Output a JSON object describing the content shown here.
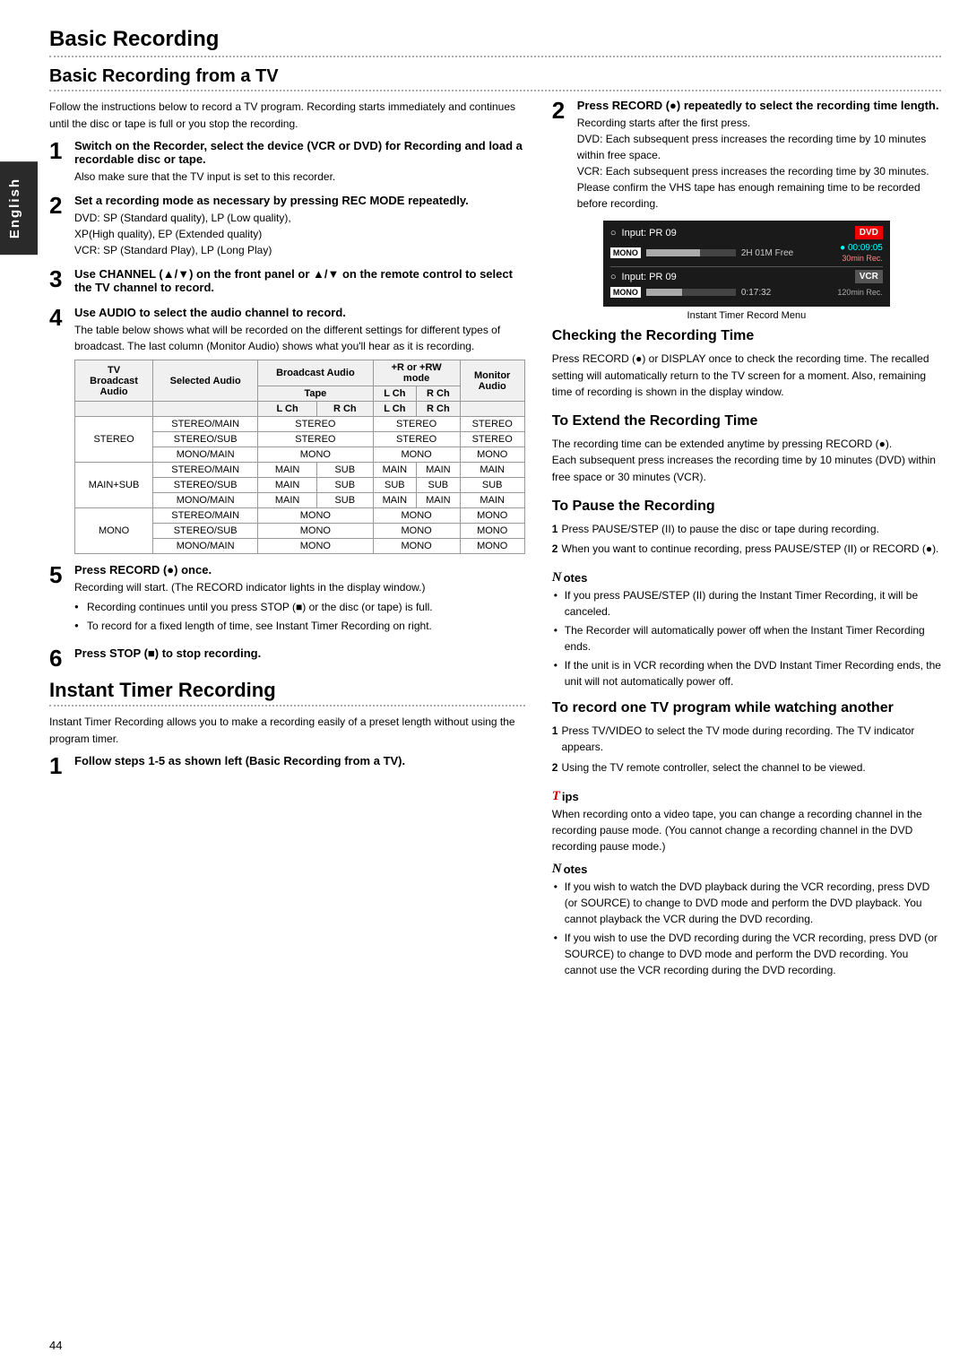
{
  "page": {
    "number": "44",
    "sidebar_label": "English"
  },
  "top_section": {
    "title": "Basic Recording",
    "subtitle": "Basic Recording from a TV",
    "intro": "Follow the instructions below to record a TV program. Recording starts immediately and continues until the disc or tape is full or you stop the recording."
  },
  "steps_left": [
    {
      "num": "1",
      "title": "Switch on the Recorder, select the device (VCR or DVD) for Recording and load a recordable disc or tape.",
      "body": "Also make sure that the TV input is set to this recorder."
    },
    {
      "num": "2",
      "title": "Set a recording mode as necessary by pressing REC MODE repeatedly.",
      "body": "DVD: SP (Standard quality), LP (Low quality), XP(High quality), EP (Extended quality)\nVCR: SP (Standard Play), LP (Long Play)"
    },
    {
      "num": "3",
      "title": "Use CHANNEL (▲/▼) on the front panel or ▲/▼ on the remote control to select the TV channel to record.",
      "body": ""
    },
    {
      "num": "4",
      "title": "Use AUDIO to select the audio channel to record.",
      "body": "The table below shows what will be recorded on the different settings for different types of broadcast. The last column (Monitor Audio) shows what you'll hear as it is recording."
    }
  ],
  "table": {
    "headers": [
      "TV Broadcast Audio",
      "Selected Audio",
      "Broadcast Audio Tape L Ch",
      "Broadcast Audio Tape R Ch",
      "Broadcast Audio +R or +RW mode L Ch",
      "Broadcast Audio +R or +RW mode R Ch",
      "Monitor Audio"
    ],
    "rows": [
      [
        "STEREO",
        "STEREO/MAIN",
        "STEREO",
        "",
        "STEREO",
        "",
        "STEREO"
      ],
      [
        "",
        "STEREO/SUB",
        "STEREO",
        "",
        "STEREO",
        "",
        "STEREO"
      ],
      [
        "",
        "MONO/MAIN",
        "MONO",
        "",
        "MONO",
        "",
        "MONO"
      ],
      [
        "MAIN+SUB",
        "STEREO/MAIN",
        "MAIN",
        "SUB",
        "MAIN",
        "MAIN",
        "MAIN"
      ],
      [
        "",
        "STEREO/SUB",
        "MAIN",
        "SUB",
        "SUB",
        "SUB",
        "SUB"
      ],
      [
        "",
        "MONO/MAIN",
        "MAIN",
        "SUB",
        "MAIN",
        "MAIN",
        "MAIN"
      ],
      [
        "MONO",
        "STEREO/MAIN",
        "MONO",
        "",
        "MONO",
        "",
        "MONO"
      ],
      [
        "",
        "STEREO/SUB",
        "MONO",
        "",
        "MONO",
        "",
        "MONO"
      ],
      [
        "",
        "MONO/MAIN",
        "MONO",
        "",
        "MONO",
        "",
        "MONO"
      ]
    ]
  },
  "steps_left_2": [
    {
      "num": "5",
      "title": "Press RECORD (●) once.",
      "body": "Recording will start. (The RECORD indicator lights in the display window.)"
    },
    {
      "num": "6",
      "title": "Press STOP (■) to stop recording.",
      "body": ""
    }
  ],
  "bullets_step5": [
    "Recording continues until you press STOP (■) or the disc (or tape) is full.",
    "To record for a fixed length of time, see Instant Timer Recording on right."
  ],
  "instant_section": {
    "title": "Instant Timer Recording",
    "intro": "Instant Timer Recording allows you to make a recording easily of a preset length without using the program timer.",
    "step1_title": "Follow steps 1-5 as shown left (Basic Recording from a TV).",
    "step1_num": "1"
  },
  "right_col": {
    "step2_title": "Press RECORD (●) repeatedly to select the recording time length.",
    "step2_num": "2",
    "step2_body": "Recording starts after the first press.",
    "step2_dvd": "DVD: Each subsequent press increases the recording time by 10 minutes within free space.",
    "step2_vcr": "VCR: Each subsequent press increases the recording time by 30 minutes. Please confirm the VHS tape has enough remaining time to be recorded before recording.",
    "menu_caption": "Instant Timer Record Menu",
    "menu_dvd_label": "DVD",
    "menu_dvd_input": "Input: PR 09",
    "menu_dvd_mono": "MONO",
    "menu_dvd_time": "2H 01M Free",
    "menu_dvd_counter": "● 00:09:05",
    "menu_dvd_rec": "30min Rec.",
    "menu_vcr_label": "VCR",
    "menu_vcr_input": "Input: PR 09",
    "menu_vcr_mono": "MONO",
    "menu_vcr_time": "0:17:32",
    "menu_vcr_rec": "120min Rec."
  },
  "checking_section": {
    "title": "Checking the Recording Time",
    "body": "Press RECORD (●) or DISPLAY once to check the recording time. The recalled setting will automatically return to the TV screen for a moment. Also, remaining time of recording is shown in the display window."
  },
  "extend_section": {
    "title": "To Extend the Recording Time",
    "body": "The recording time can be extended anytime by pressing RECORD (●).\nEach subsequent press increases the recording time by 10 minutes (DVD) within free space or 30 minutes (VCR)."
  },
  "pause_section": {
    "title": "To Pause the Recording",
    "step1": "Press PAUSE/STEP (II) to pause the disc or tape during recording.",
    "step2": "When you want to continue recording, press PAUSE/STEP (II) or RECORD (●)."
  },
  "notes_right": [
    "If you press PAUSE/STEP (II) during the Instant Timer Recording, it will be canceled.",
    "The Recorder will automatically power off when the Instant Timer Recording ends.",
    "If the unit is in VCR recording when the DVD Instant Timer Recording ends, the unit will not automatically power off."
  ],
  "record_while_watching": {
    "title": "To record one TV program while watching another",
    "step1": "Press TV/VIDEO to select the TV mode during recording. The TV indicator appears.",
    "step2": "Using the TV remote controller, select the channel to be viewed."
  },
  "tips_right": "When recording onto a video tape, you can change a recording channel in the recording pause mode. (You cannot change a recording channel in the DVD recording pause mode.)",
  "notes_bottom": [
    "If you wish to watch the DVD playback during the VCR recording, press DVD (or SOURCE) to change to DVD mode and perform the DVD playback. You cannot playback the VCR during the DVD recording.",
    "If you wish to use the DVD recording during the VCR recording, press DVD (or SOURCE) to change to DVD mode and perform the DVD recording. You cannot use the VCR recording during the DVD recording."
  ]
}
